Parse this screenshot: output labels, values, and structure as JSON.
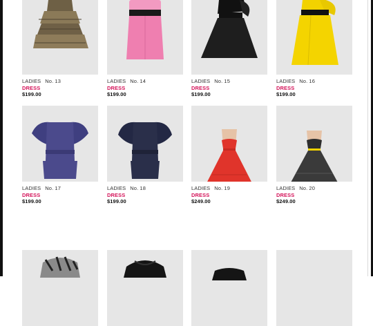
{
  "products": [
    {
      "section": "LADIES",
      "number": "No. 13",
      "category": "DRESS",
      "price": "$199.00",
      "dress": "gold-ruffle-icon",
      "color": "#7a6a4e"
    },
    {
      "section": "LADIES",
      "number": "No. 14",
      "category": "DRESS",
      "price": "$199.00",
      "dress": "pink-strapless-icon",
      "color": "#ef7fb0"
    },
    {
      "section": "LADIES",
      "number": "No. 15",
      "category": "DRESS",
      "price": "$199.00",
      "dress": "black-one-shoulder-icon",
      "color": "#1e1e1e"
    },
    {
      "section": "LADIES",
      "number": "No. 16",
      "category": "DRESS",
      "price": "$199.00",
      "dress": "yellow-one-shoulder-icon",
      "color": "#f4d400"
    },
    {
      "section": "LADIES",
      "number": "No. 17",
      "category": "DRESS",
      "price": "$199.00",
      "dress": "purple-ruffle-sleeve-icon",
      "color": "#4b4a8c"
    },
    {
      "section": "LADIES",
      "number": "No. 18",
      "category": "DRESS",
      "price": "$199.00",
      "dress": "navy-ruffle-sleeve-icon",
      "color": "#2a2f4a"
    },
    {
      "section": "LADIES",
      "number": "No. 19",
      "category": "DRESS",
      "price": "$249.00",
      "dress": "red-tulle-icon",
      "color": "#e0342b"
    },
    {
      "section": "LADIES",
      "number": "No. 20",
      "category": "DRESS",
      "price": "$249.00",
      "dress": "black-tulle-icon",
      "color": "#3a3a3a"
    },
    {
      "dress": "zebra-print-icon",
      "color": "#6b6b6b"
    },
    {
      "dress": "black-ruffle-top-icon",
      "color": "#151515"
    },
    {
      "dress": "black-top-icon",
      "color": "#151515"
    },
    {
      "dress": "empty-image-icon",
      "color": "#e6e6e6"
    }
  ]
}
